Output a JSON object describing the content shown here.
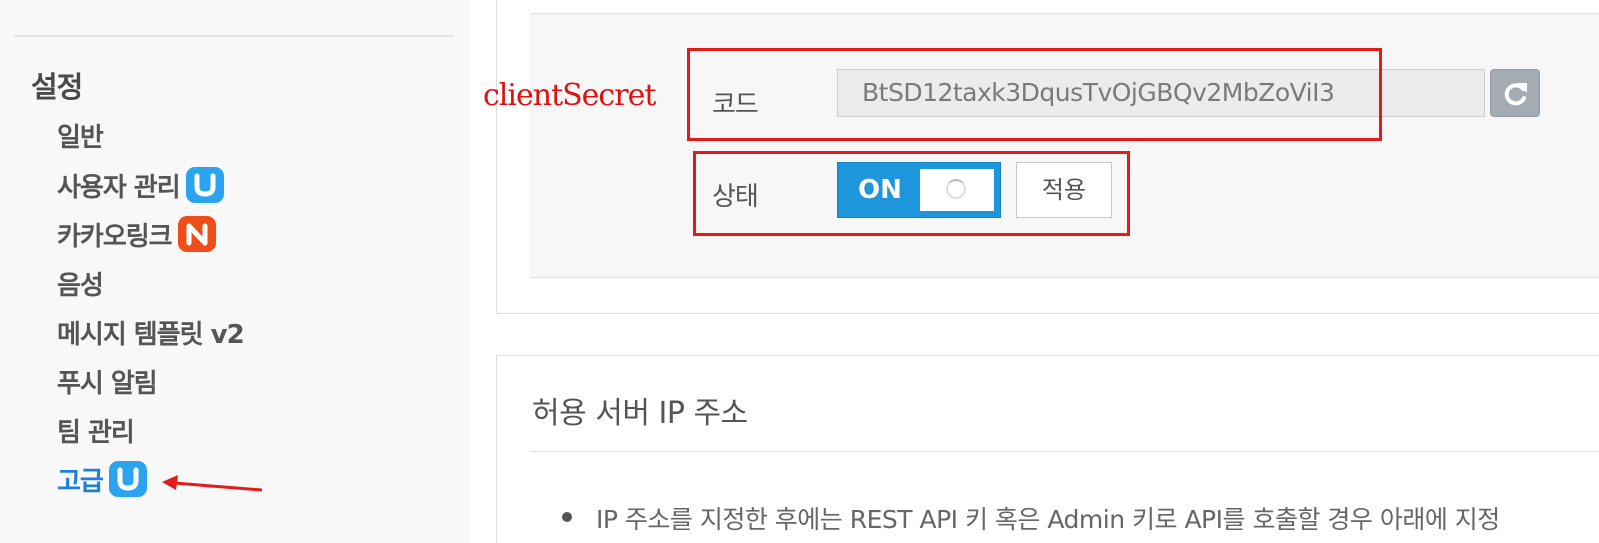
{
  "sidebar": {
    "heading": "설정",
    "items": [
      {
        "label": "일반"
      },
      {
        "label": "사용자 관리",
        "badge": "U"
      },
      {
        "label": "카카오링크",
        "badge": "N"
      },
      {
        "label": "음성"
      },
      {
        "label": "메시지 템플릿 v2"
      },
      {
        "label": "푸시 알림"
      },
      {
        "label": "팀 관리"
      },
      {
        "label": "고급",
        "badge": "U",
        "active": true
      }
    ]
  },
  "annotation": {
    "label": "clientSecret",
    "color": "#e41b1b"
  },
  "security": {
    "code_label": "코드",
    "code_value": "BtSD12taxk3DqusTvOjGBQv2MbZoViI3",
    "status_label": "상태",
    "toggle_text": "ON",
    "toggle_state": "on",
    "apply_label": "적용",
    "refresh_icon": "refresh-icon"
  },
  "ip_section": {
    "title": "허용 서버 IP 주소",
    "info": "IP 주소를 지정한 후에는 REST API 키 혹은 Admin 키로 API를 호출할 경우 아래에 지정"
  },
  "colors": {
    "accent": "#1e96dc",
    "active_nav": "#1d7fd8",
    "badge_u": "#2aa4ef",
    "badge_n": "#f04e18",
    "annotation": "#e41b1b"
  }
}
